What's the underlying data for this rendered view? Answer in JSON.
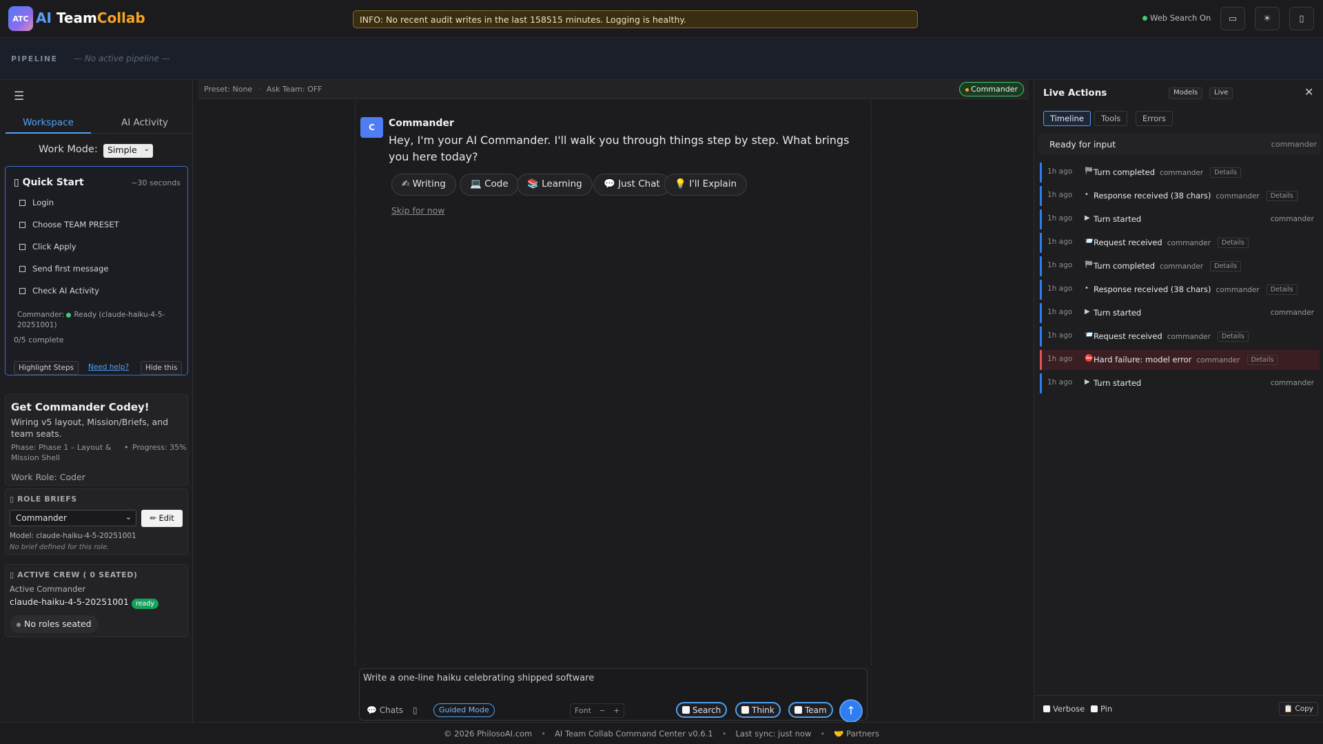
{
  "header": {
    "logo_badge": "ATC",
    "logo_ai": "AI",
    "logo_team": "Team",
    "logo_collab": "Collab",
    "info_banner": "INFO: No recent audit writes in the last 158515 minutes. Logging is healthy.",
    "web_search": "Web Search On",
    "icons": [
      "monitor-icon",
      "sun-icon",
      "phone-icon"
    ]
  },
  "pipeline": {
    "label": "PIPELINE",
    "status": "— No active pipeline —"
  },
  "sidebar": {
    "tabs": [
      {
        "label": "Workspace",
        "active": true
      },
      {
        "label": "AI Activity",
        "active": false
      }
    ],
    "work_mode_label": "Work Mode:",
    "work_mode_value": "Simple",
    "quick_start": {
      "title": "Quick Start",
      "time": "~30 seconds",
      "steps": [
        "Login",
        "Choose TEAM PRESET",
        "Click Apply",
        "Send first message",
        "Check AI Activity"
      ],
      "commander_label": "Commander:",
      "commander_status": "Ready (claude-haiku-4-5-20251001)",
      "complete": "0/5 complete",
      "highlight_btn": "Highlight Steps",
      "help_link": "Need help?",
      "hide_btn": "Hide this"
    },
    "codey": {
      "title": "Get Commander Codey!",
      "desc": "Wiring v5 layout, Mission/Briefs, and team seats.",
      "phase": "Phase: Phase 1 – Layout & Mission Shell",
      "progress": "Progress: 35%",
      "role": "Work Role: Coder"
    },
    "briefs": {
      "title": "ROLE BRIEFS",
      "selected": "Commander",
      "edit_btn": "✏ Edit",
      "model": "Model: claude-haiku-4-5-20251001",
      "none": "No brief defined for this role."
    },
    "crew": {
      "title": "ACTIVE CREW ( 0 SEATED)",
      "active_label": "Active Commander",
      "model": "claude-haiku-4-5-20251001",
      "badge": "ready",
      "no_roles": "No roles seated"
    }
  },
  "center": {
    "preset": "Preset: None",
    "ask_team": "Ask Team: OFF",
    "commander_pill": "Commander",
    "message": {
      "avatar": "C",
      "name": "Commander",
      "text": "Hey, I'm your AI Commander. I'll walk you through things step by step. What brings you here today?",
      "choices": [
        "✍ Writing",
        "💻 Code",
        "📚 Learning",
        "💬 Just Chat",
        "💡 I'll Explain"
      ],
      "skip": "Skip for now"
    },
    "composer": {
      "text": "Write a one-line haiku celebrating shipped software",
      "chats": "💬 Chats",
      "guided": "Guided Mode",
      "font_label": "Font",
      "font_minus": "−",
      "font_plus": "+",
      "search": "Search",
      "think": "Think",
      "team": "Team",
      "send": "↑"
    }
  },
  "live_actions": {
    "title": "Live Actions",
    "models_btn": "Models",
    "live_btn": "Live",
    "close": "✕",
    "tabs": [
      {
        "label": "Timeline",
        "active": true
      },
      {
        "label": "Tools",
        "active": false
      },
      {
        "label": "Errors",
        "active": false
      }
    ],
    "ready": "Ready for input",
    "ready_tag": "commander",
    "events": [
      {
        "time": "1h ago",
        "icon": "🏁",
        "text": "Turn completed",
        "tag": "commander",
        "details": "Details",
        "error": false
      },
      {
        "time": "1h ago",
        "icon": "•",
        "text": "Response received (38 chars)",
        "tag": "commander",
        "details": "Details",
        "error": false
      },
      {
        "time": "1h ago",
        "icon": "▶",
        "text": "Turn started",
        "tag": "commander",
        "details": "",
        "error": false
      },
      {
        "time": "1h ago",
        "icon": "📨",
        "text": "Request received",
        "tag": "commander",
        "details": "Details",
        "error": false
      },
      {
        "time": "1h ago",
        "icon": "🏁",
        "text": "Turn completed",
        "tag": "commander",
        "details": "Details",
        "error": false
      },
      {
        "time": "1h ago",
        "icon": "•",
        "text": "Response received (38 chars)",
        "tag": "commander",
        "details": "Details",
        "error": false
      },
      {
        "time": "1h ago",
        "icon": "▶",
        "text": "Turn started",
        "tag": "commander",
        "details": "",
        "error": false
      },
      {
        "time": "1h ago",
        "icon": "📨",
        "text": "Request received",
        "tag": "commander",
        "details": "Details",
        "error": false
      },
      {
        "time": "1h ago",
        "icon": "⛔",
        "text": "Hard failure: model error",
        "tag": "commander",
        "details": "Details",
        "error": true
      },
      {
        "time": "1h ago",
        "icon": "▶",
        "text": "Turn started",
        "tag": "commander",
        "details": "",
        "error": false
      }
    ],
    "verbose": "Verbose",
    "pin": "Pin",
    "copy": "📋 Copy"
  },
  "footer": {
    "copyright": "© 2026 PhilosoAI.com",
    "app": "AI Team Collab Command Center v0.6.1",
    "sync": "Last sync: just now",
    "partners": "🤝 Partners"
  },
  "colors": {
    "accent": "#4ea3f5",
    "success": "#3ecf6e",
    "error": "#e05555",
    "warning_bg": "#3a2e12"
  }
}
